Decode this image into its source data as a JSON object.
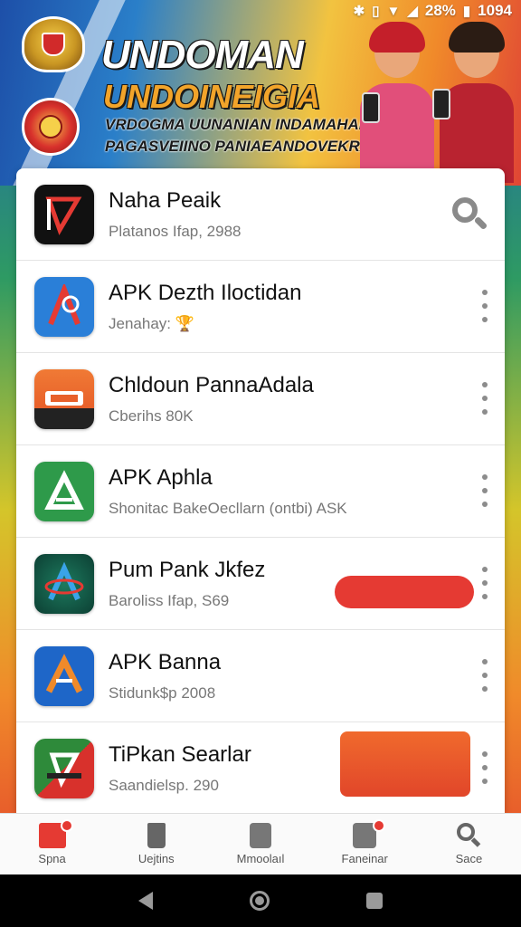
{
  "status_bar": {
    "battery": "28%",
    "time": "1094"
  },
  "banner": {
    "title": "UNDOMAN",
    "subtitle": "UNDOINEIGIA",
    "tagline1": "VRDOGMA UUNANIAN INDAMAHAN",
    "tagline2": "PAGASVEIINO PANIAEANDOVEKRAN!"
  },
  "apps": [
    {
      "name": "Naha Peaik",
      "subtitle": "Platanos Ifap, 2988",
      "icon": "black-red-app-icon",
      "color": "#111111",
      "action": "search"
    },
    {
      "name": "APK Dezth Iloctidan",
      "subtitle": "Jenahay: 🏆",
      "icon": "blue-a-app-icon",
      "color": "#2a7fd8",
      "action": "menu"
    },
    {
      "name": "Chldoun PannaAdala",
      "subtitle": "Cberihs 80K",
      "icon": "orange-app-icon",
      "color": "#e8602a",
      "action": "menu"
    },
    {
      "name": "APK Aphla",
      "subtitle": "Shonitac BakeOecllarn (ontbi) ASK",
      "icon": "green-a-app-icon",
      "color": "#2e9a4a",
      "action": "menu"
    },
    {
      "name": "Pum Pank Jkfez",
      "subtitle": "Baroliss Ifap, S69",
      "icon": "teal-a-app-icon",
      "color": "#0f5b4a",
      "action": "menu"
    },
    {
      "name": "APK Banna",
      "subtitle": "Stidunk$p 2008",
      "icon": "blue-orange-a-app-icon",
      "color": "#1e66c8",
      "action": "menu"
    },
    {
      "name": "TiPkan Searlar",
      "subtitle": "Saandielsp. 290",
      "icon": "green-red-app-icon",
      "color": "#2e8a3a",
      "action": "menu"
    }
  ],
  "bottom_nav": [
    {
      "label": "Spna",
      "icon": "home-icon"
    },
    {
      "label": "Uejtins",
      "icon": "trash-icon"
    },
    {
      "label": "Mmoolaıl",
      "icon": "document-icon"
    },
    {
      "label": "Faneinar",
      "icon": "book-icon"
    },
    {
      "label": "Sace",
      "icon": "search-icon"
    }
  ]
}
